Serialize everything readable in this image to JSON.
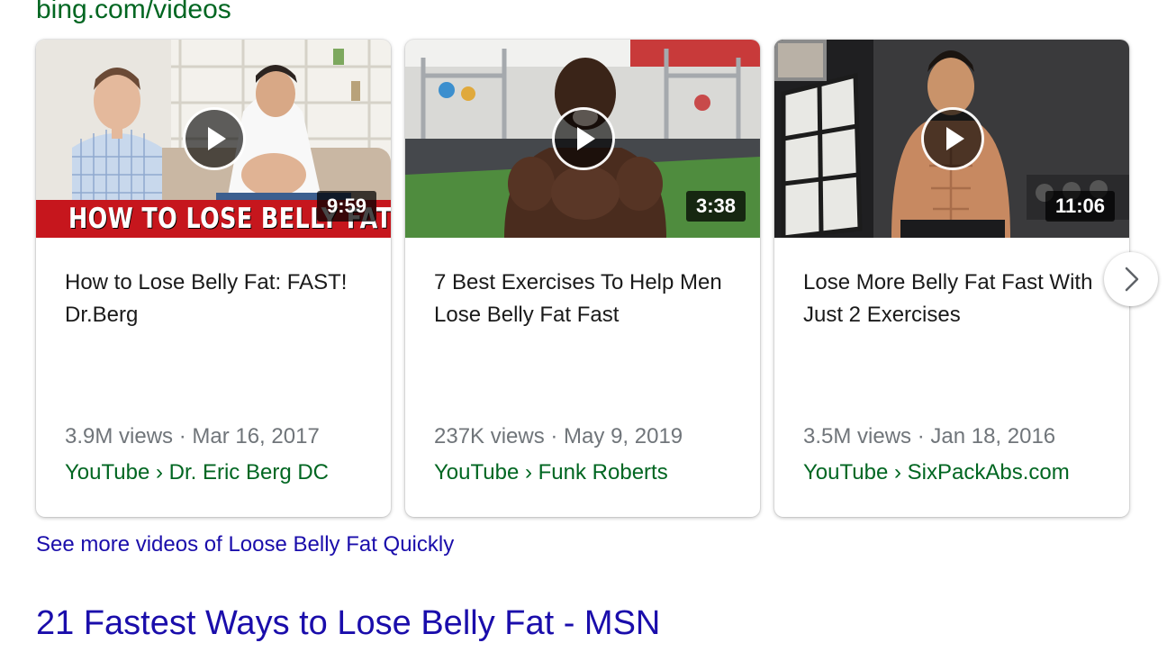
{
  "source_url": "bing.com/videos",
  "colors": {
    "url_green": "#006621",
    "link_blue": "#1a0dab",
    "meta_gray": "#70757a",
    "banner_red": "#c6161d"
  },
  "videos": [
    {
      "thumbnail_caption": "HOW TO LOSE BELLY FAT",
      "duration": "9:59",
      "title": "How to Lose Belly Fat: FAST! Dr.Berg",
      "meta": "3.9M views · Mar 16, 2017",
      "source": "YouTube › Dr. Eric Berg DC"
    },
    {
      "duration": "3:38",
      "title": "7 Best Exercises To Help Men Lose Belly Fat Fast",
      "meta": "237K views · May 9, 2019",
      "source": "YouTube › Funk Roberts"
    },
    {
      "duration": "11:06",
      "title": "Lose More Belly Fat Fast With Just 2 Exercises",
      "meta": "3.5M views · Jan 18, 2016",
      "source": "YouTube › SixPackAbs.com"
    }
  ],
  "icons": {
    "play": "play-icon",
    "next": "chevron-right-icon"
  },
  "see_more_link": "See more videos of Loose Belly Fat Quickly",
  "next_result_title": "21 Fastest Ways to Lose Belly Fat - MSN"
}
